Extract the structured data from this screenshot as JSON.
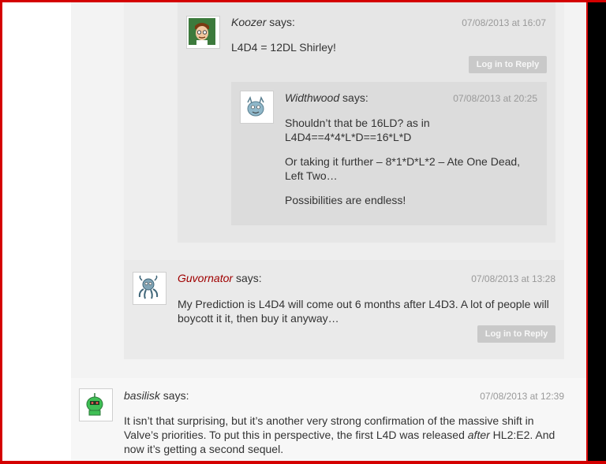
{
  "comments": {
    "koozer": {
      "author": "Koozer",
      "says": "says:",
      "date": "07/08/2013 at 16:07",
      "text": "L4D4 = 12DL Shirley!",
      "reply_label": "Log in to Reply"
    },
    "widthwood": {
      "author": "Widthwood",
      "says": "says:",
      "date": "07/08/2013 at 20:25",
      "p1a": "Shouldn’t that be 16LD? as in",
      "p1b": "L4D4==4*4*L*D==16*L*D",
      "p2a": "Or taking it further – 8*1*D*L*2 – Ate One Dead,",
      "p2b": "Left Two…",
      "p3": "Possibilities are endless!"
    },
    "guvornator": {
      "author": "Guvornator",
      "says": "says:",
      "date": "07/08/2013 at 13:28",
      "line1": "My Prediction is L4D4 will come out 6 months after L4D3. A lot of people will",
      "line2": "boycott it it, then buy it anyway…",
      "reply_label": "Log in to Reply"
    },
    "basilisk": {
      "author": "basilisk",
      "says": "says:",
      "date": "07/08/2013 at 12:39",
      "line1": "It isn’t that surprising, but it’s another very strong confirmation of the massive shift in",
      "line2_pre": "Valve’s priorities. To put this in perspective, the first L4D was released ",
      "line2_em": "after",
      "line2_post": " HL2:E2. And",
      "line3": "now it’s getting a second sequel."
    }
  },
  "icons": {
    "koozer_avatar": "cartoon-man-avatar-icon",
    "widthwood_avatar": "blue-creature-avatar-icon",
    "guvornator_avatar": "octopus-avatar-icon",
    "basilisk_avatar": "green-robot-avatar-icon"
  },
  "colors": {
    "author_link": "#a00000",
    "frame_red": "#d40000",
    "reply_button": "#c9c9c9"
  }
}
